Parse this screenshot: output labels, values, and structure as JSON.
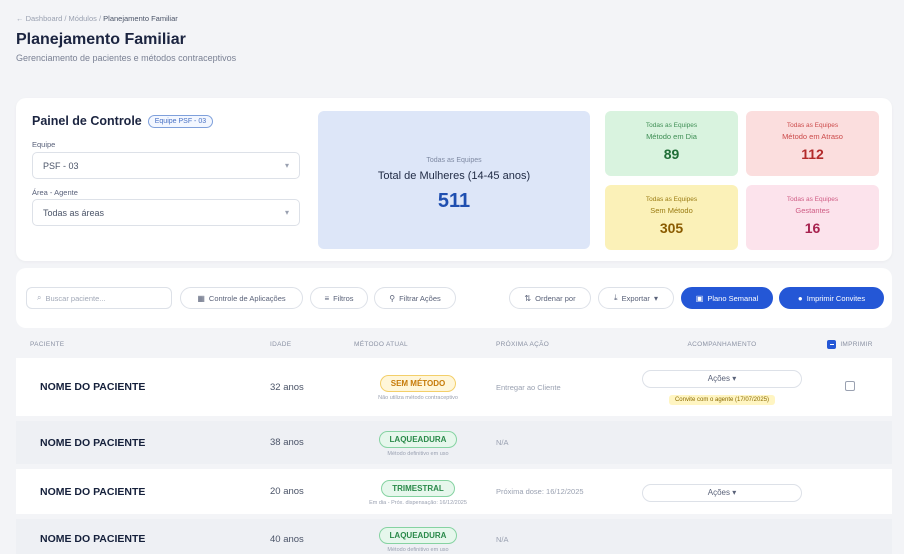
{
  "breadcrumb": {
    "back": "←",
    "trail": "Dashboard / Módulos /",
    "current": "Planejamento Familiar"
  },
  "page": {
    "title": "Planejamento Familiar",
    "subtitle": "Gerenciamento de pacientes e métodos contraceptivos"
  },
  "panel": {
    "title": "Painel de Controle",
    "team_badge": "Equipe PSF - 03",
    "team_label": "Equipe",
    "team_value": "PSF - 03",
    "area_label": "Área - Agente",
    "area_value": "Todas as áreas"
  },
  "total": {
    "small": "Todas as Equipes",
    "label": "Total de Mulheres (14-45 anos)",
    "value": "511"
  },
  "stats": [
    {
      "small": "Todas as Equipes",
      "label": "Método em Dia",
      "value": "89"
    },
    {
      "small": "Todas as Equipes",
      "label": "Método em Atraso",
      "value": "112"
    },
    {
      "small": "Todas as Equipes",
      "label": "Sem Método",
      "value": "305"
    },
    {
      "small": "Todas as Equipes",
      "label": "Gestantes",
      "value": "16"
    }
  ],
  "toolbar": {
    "search_placeholder": "Buscar paciente...",
    "controle": "Controle de Aplicações",
    "filtros": "Filtros",
    "filtrar_acoes": "Filtrar Ações",
    "ordenar": "Ordenar por",
    "exportar": "Exportar",
    "plano": "Plano Semanal",
    "imprimir": "Imprimir Convites"
  },
  "table": {
    "headers": [
      "PACIENTE",
      "IDADE",
      "MÉTODO ATUAL",
      "PRÓXIMA AÇÃO",
      "ACOMPANHAMENTO",
      "IMPRIMIR"
    ],
    "rows": [
      {
        "name": "NOME DO PACIENTE",
        "age": "32 anos",
        "method": "SEM MÉTODO",
        "method_sub": "Não utiliza método contraceptivo",
        "next": "Entregar ao Cliente",
        "actions": "Ações",
        "invite": "Convite com o agente (17/07/2025)"
      },
      {
        "name": "NOME DO PACIENTE",
        "age": "38 anos",
        "method": "LAQUEADURA",
        "method_sub": "Método definitivo em uso",
        "next": "N/A"
      },
      {
        "name": "NOME DO PACIENTE",
        "age": "20 anos",
        "method": "TRIMESTRAL",
        "method_sub": "Em dia - Próx. dispensação: 16/12/2025",
        "next": "Próxima dose: 16/12/2025",
        "actions": "Ações"
      },
      {
        "name": "NOME DO PACIENTE",
        "age": "40 anos",
        "method": "LAQUEADURA",
        "method_sub": "Método definitivo em uso",
        "next": "N/A"
      }
    ]
  },
  "colors": {
    "primary": "#2457d6",
    "green": "#1f6e36",
    "red": "#b22a2a",
    "yellow": "#8a5b00",
    "pink": "#a7224f"
  },
  "icons": [
    "search-icon",
    "calendar-icon",
    "filter-icon",
    "sort-icon",
    "download-icon",
    "plan-icon",
    "print-icon",
    "chevron-down-icon"
  ]
}
